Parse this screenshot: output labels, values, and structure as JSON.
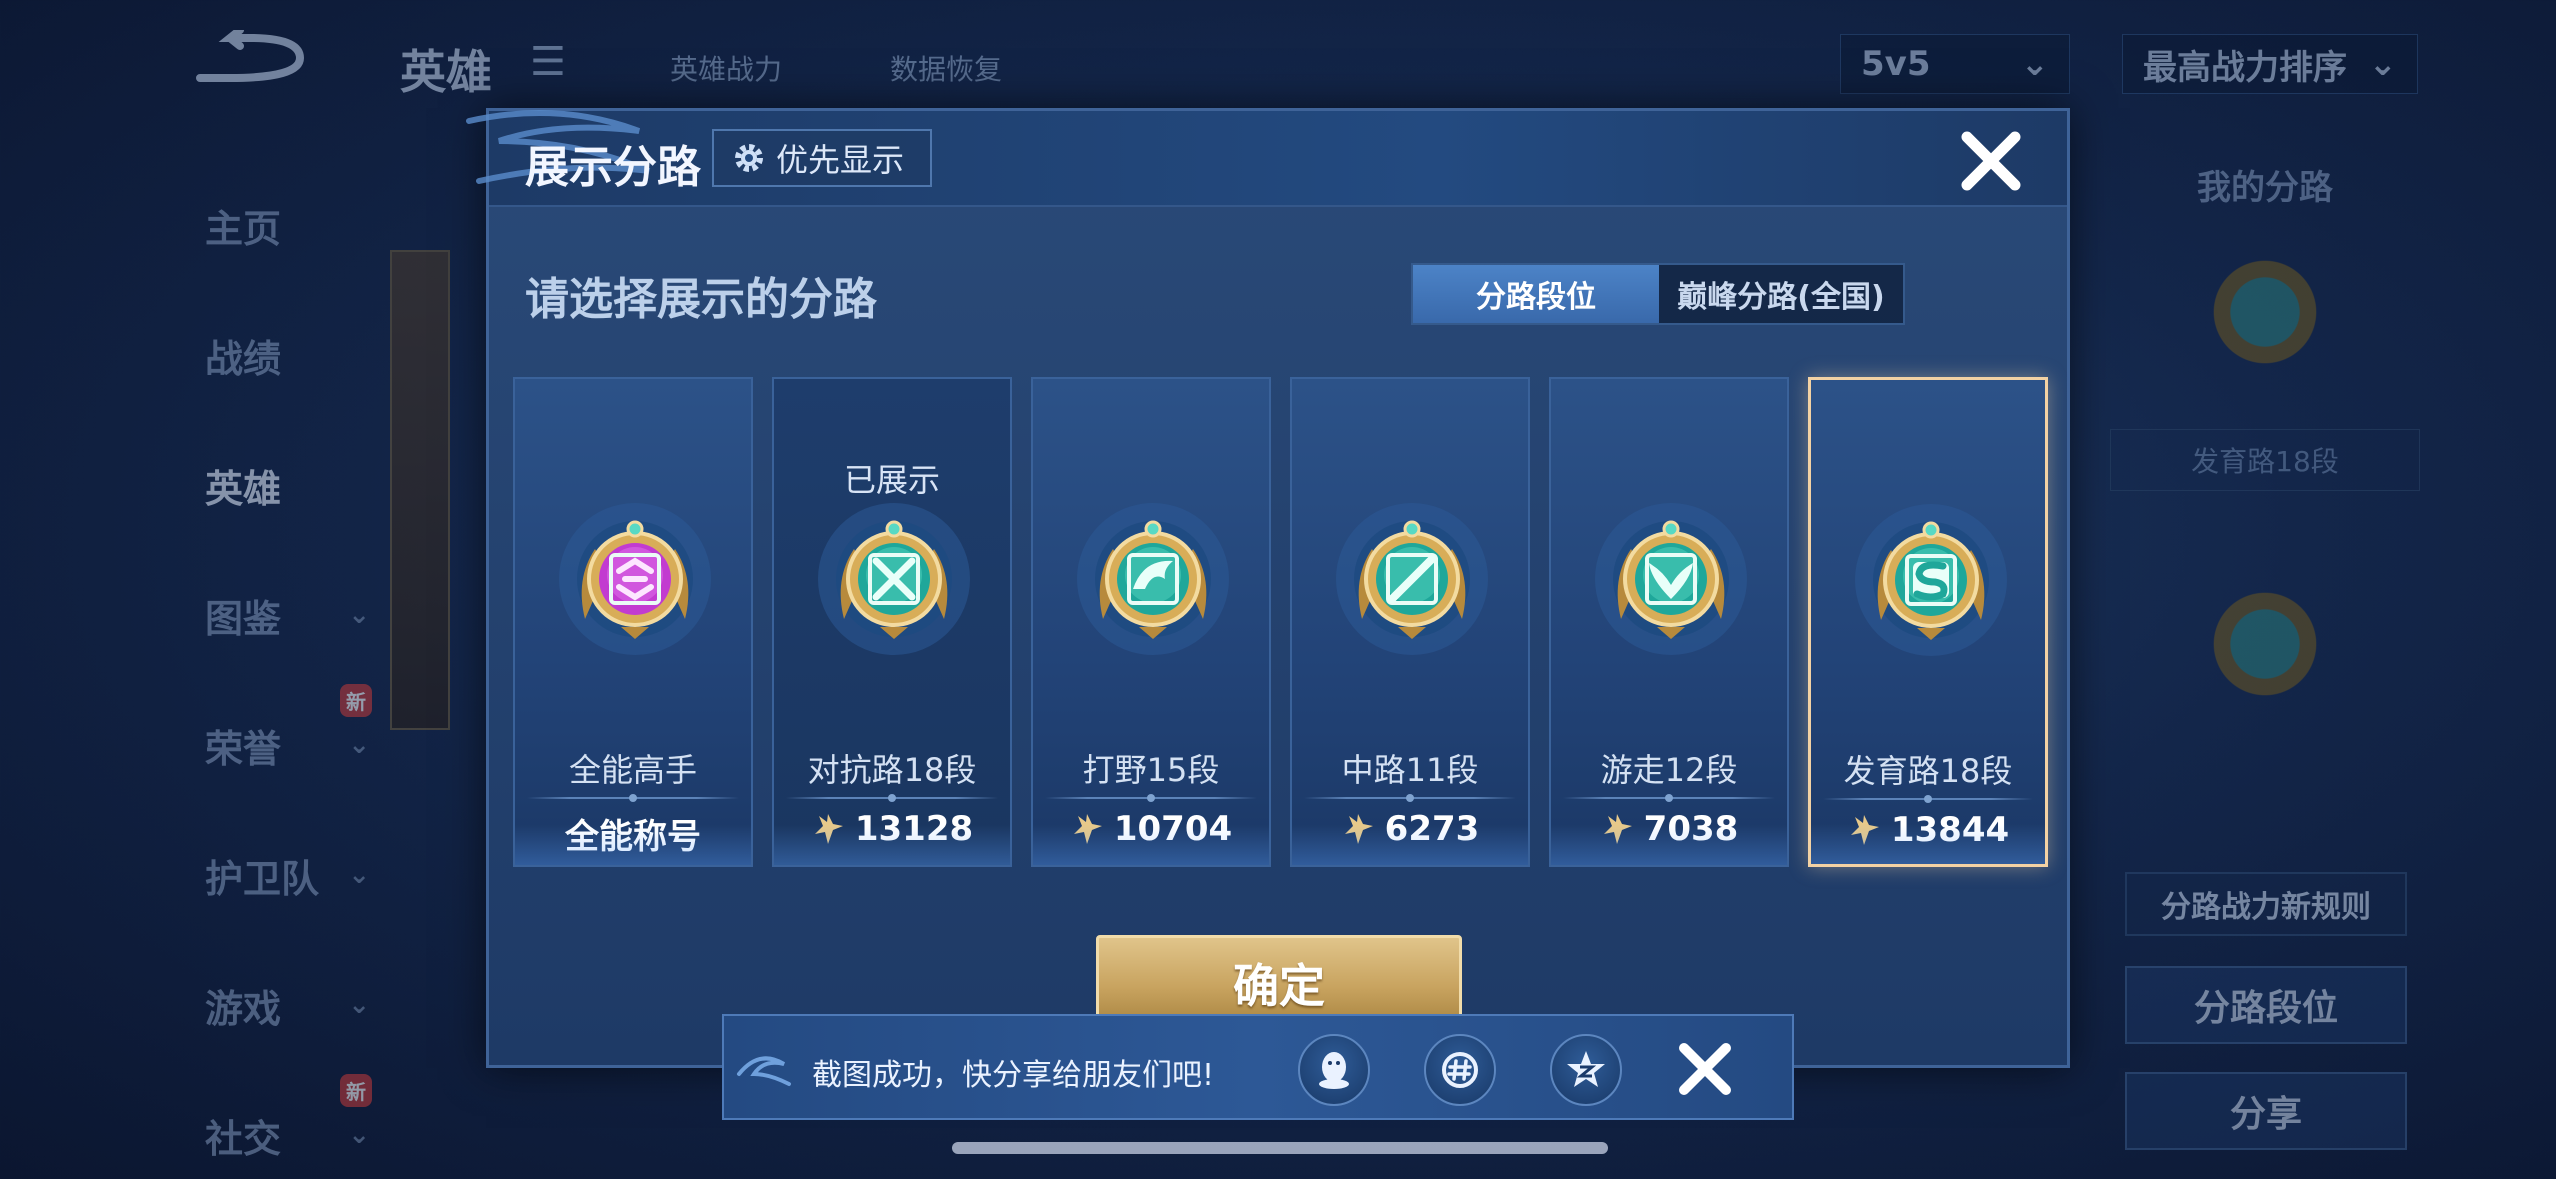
{
  "background": {
    "top_title": "英雄",
    "top_links": [
      "英雄战力",
      "数据恢复"
    ],
    "mode_dropdown": "5v5",
    "sort_dropdown": "最高战力排序",
    "side_menu": [
      {
        "label": "主页",
        "chevron": false,
        "new": false,
        "active": false
      },
      {
        "label": "战绩",
        "chevron": false,
        "new": false,
        "active": false
      },
      {
        "label": "英雄",
        "chevron": false,
        "new": false,
        "active": true
      },
      {
        "label": "图鉴",
        "chevron": true,
        "new": false,
        "active": false
      },
      {
        "label": "荣誉",
        "chevron": true,
        "new": true,
        "active": false
      },
      {
        "label": "护卫队",
        "chevron": true,
        "new": false,
        "active": false
      },
      {
        "label": "游戏",
        "chevron": true,
        "new": false,
        "active": false
      },
      {
        "label": "社交",
        "chevron": true,
        "new": true,
        "active": false
      }
    ],
    "new_badge": "新",
    "right_panel": {
      "title": "我的分路",
      "lane_label": "发育路18段",
      "rule_button": "分路战力新规则",
      "rank_button": "分路段位",
      "share_button": "分享"
    }
  },
  "modal": {
    "title": "展示分路",
    "priority_button": "优先显示",
    "subtitle": "请选择展示的分路",
    "tabs": [
      {
        "label": "分路段位",
        "active": true
      },
      {
        "label": "巅峰分路(全国)",
        "active": false
      }
    ],
    "cards": [
      {
        "status": "",
        "name": "全能高手",
        "value": "全能称号",
        "show_icon": false,
        "emblem": "all-round-emblem-icon",
        "selected": false,
        "shown": false
      },
      {
        "status": "已展示",
        "name": "对抗路18段",
        "value": "13128",
        "show_icon": true,
        "emblem": "clash-lane-emblem-icon",
        "selected": false,
        "shown": true
      },
      {
        "status": "",
        "name": "打野15段",
        "value": "10704",
        "show_icon": true,
        "emblem": "jungle-emblem-icon",
        "selected": false,
        "shown": false
      },
      {
        "status": "",
        "name": "中路11段",
        "value": "6273",
        "show_icon": true,
        "emblem": "mid-lane-emblem-icon",
        "selected": false,
        "shown": false
      },
      {
        "status": "",
        "name": "游走12段",
        "value": "7038",
        "show_icon": true,
        "emblem": "roam-emblem-icon",
        "selected": false,
        "shown": false
      },
      {
        "status": "",
        "name": "发育路18段",
        "value": "13844",
        "show_icon": true,
        "emblem": "farm-lane-emblem-icon",
        "selected": true,
        "shown": false
      }
    ],
    "confirm_button": "确定"
  },
  "toast": {
    "message": "截图成功，快分享给朋友们吧!",
    "share_targets": [
      "qq-icon",
      "wechat-moments-icon",
      "qzone-icon"
    ]
  },
  "colors": {
    "accent_blue": "#3969ab",
    "gold": "#c8a35f",
    "selected_border": "#f3d2a4"
  }
}
